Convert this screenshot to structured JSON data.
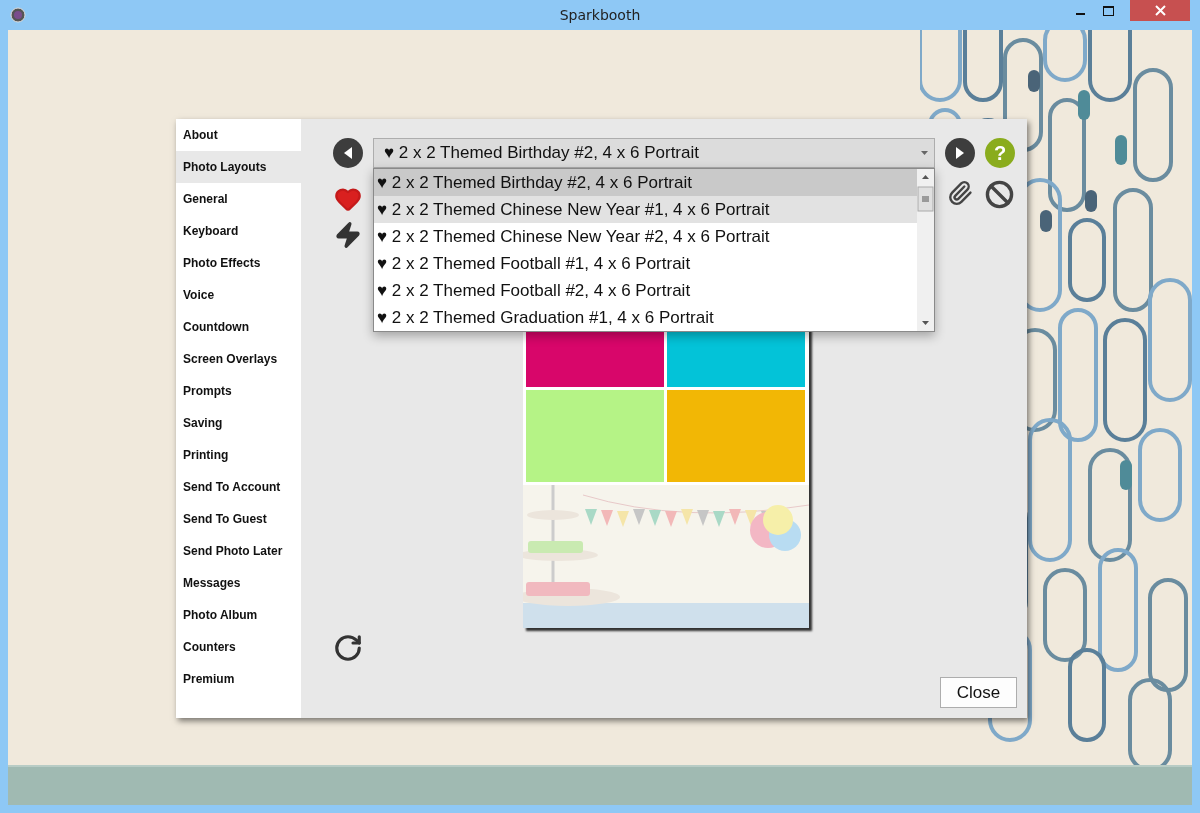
{
  "window": {
    "title": "Sparkbooth"
  },
  "sidebar": {
    "items": [
      {
        "label": "About",
        "selected": false
      },
      {
        "label": "Photo Layouts",
        "selected": true
      },
      {
        "label": "General",
        "selected": false
      },
      {
        "label": "Keyboard",
        "selected": false
      },
      {
        "label": "Photo Effects",
        "selected": false
      },
      {
        "label": "Voice",
        "selected": false
      },
      {
        "label": "Countdown",
        "selected": false
      },
      {
        "label": "Screen Overlays",
        "selected": false
      },
      {
        "label": "Prompts",
        "selected": false
      },
      {
        "label": "Saving",
        "selected": false
      },
      {
        "label": "Printing",
        "selected": false
      },
      {
        "label": "Send To Account",
        "selected": false
      },
      {
        "label": "Send To Guest",
        "selected": false
      },
      {
        "label": "Send Photo Later",
        "selected": false
      },
      {
        "label": "Messages",
        "selected": false
      },
      {
        "label": "Photo Album",
        "selected": false
      },
      {
        "label": "Counters",
        "selected": false
      },
      {
        "label": "Premium",
        "selected": false
      }
    ]
  },
  "layout_picker": {
    "value": "♥ 2 x 2 Themed Birthday #2, 4 x 6 Portrait",
    "expanded": true,
    "options": [
      {
        "label": "♥ 2 x 2 Themed Birthday #2, 4 x 6 Portrait",
        "selected": true,
        "hovered": false
      },
      {
        "label": "♥ 2 x 2 Themed Chinese New Year #1, 4 x 6 Portrait",
        "selected": false,
        "hovered": true
      },
      {
        "label": "♥ 2 x 2 Themed Chinese New Year #2, 4 x 6 Portrait",
        "selected": false,
        "hovered": false
      },
      {
        "label": "♥ 2 x 2 Themed Football #1, 4 x 6 Portrait",
        "selected": false,
        "hovered": false
      },
      {
        "label": "♥ 2 x 2 Themed Football #2, 4 x 6 Portrait",
        "selected": false,
        "hovered": false
      },
      {
        "label": "♥ 2 x 2 Themed Graduation #1, 4 x 6 Portrait",
        "selected": false,
        "hovered": false
      }
    ]
  },
  "help_button": {
    "label": "?"
  },
  "preview": {
    "cells": [
      {
        "color": "#d8066a"
      },
      {
        "color": "#03c3d8"
      },
      {
        "color": "#b5f386"
      },
      {
        "color": "#f2b705"
      }
    ],
    "kind": "picture"
  },
  "close_button": {
    "label": "Close"
  }
}
